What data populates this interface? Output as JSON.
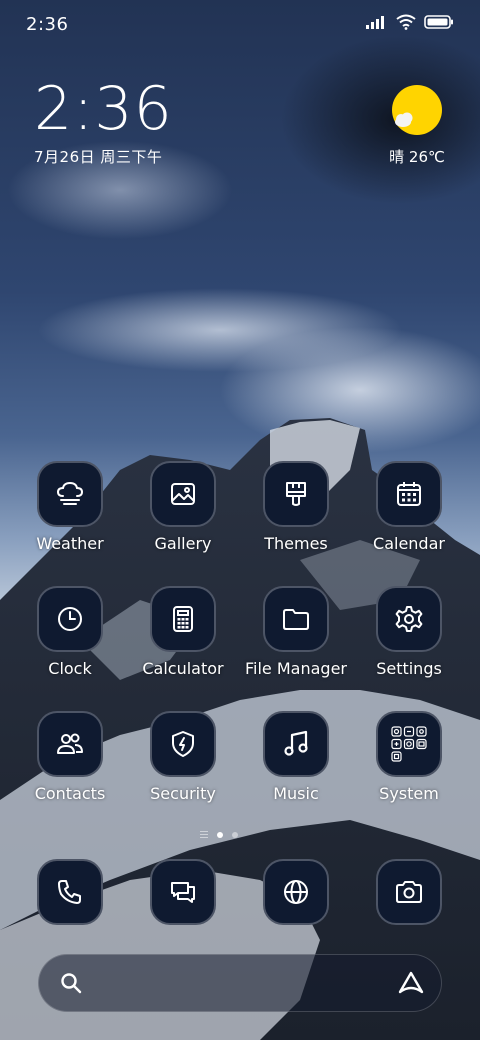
{
  "status_bar": {
    "time": "2:36",
    "icons": [
      "signal-icon",
      "wifi-icon",
      "battery-icon"
    ]
  },
  "clock_widget": {
    "time": "2:36",
    "date": "7月26日 周三下午"
  },
  "weather_widget": {
    "icon": "sunny-partly-cloudy-icon",
    "text": "晴 26℃",
    "sun_color": "#FFD400"
  },
  "apps": [
    {
      "label": "Weather",
      "icon": "weather-fog-icon"
    },
    {
      "label": "Gallery",
      "icon": "gallery-icon"
    },
    {
      "label": "Themes",
      "icon": "paintbrush-icon"
    },
    {
      "label": "Calendar",
      "icon": "calendar-icon"
    },
    {
      "label": "Clock",
      "icon": "clock-icon"
    },
    {
      "label": "Calculator",
      "icon": "calculator-icon"
    },
    {
      "label": "File Manager",
      "icon": "folder-icon"
    },
    {
      "label": "Settings",
      "icon": "gear-icon"
    },
    {
      "label": "Contacts",
      "icon": "contacts-icon"
    },
    {
      "label": "Security",
      "icon": "security-shield-icon"
    },
    {
      "label": "Music",
      "icon": "music-note-icon"
    },
    {
      "label": "System",
      "icon": "folder-grid-icon"
    }
  ],
  "page_indicator": {
    "pages": 2,
    "active_page": 1
  },
  "dock": [
    {
      "icon": "phone-icon"
    },
    {
      "icon": "messages-icon"
    },
    {
      "icon": "browser-globe-icon"
    },
    {
      "icon": "camera-icon"
    }
  ],
  "search_bar": {
    "left_icon": "search-icon",
    "right_icon": "assistant-icon"
  },
  "colors": {
    "icon_background": "#0F1A30",
    "icon_border": "#4D5566",
    "text": "#FFFFFF"
  }
}
